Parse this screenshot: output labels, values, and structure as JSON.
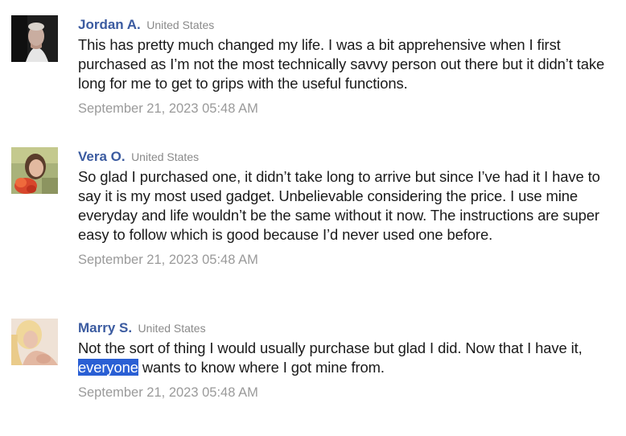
{
  "reviews": [
    {
      "name": "Jordan A.",
      "country": "United States",
      "text": "This has pretty much changed my life. I was a bit apprehensive when I first purchased as I’m not the most technically savvy person out there but it didn’t take long for me to get to grips with the useful functions.",
      "date": "September 21, 2023 05:48 AM"
    },
    {
      "name": "Vera O.",
      "country": "United States",
      "text": "So glad I purchased one, it didn’t take long to arrive but since I’ve had it I have to say it is my most used gadget. Unbelievable considering the price. I use mine everyday and life wouldn’t be the same without it now. The instructions are super easy to follow which is good because I’d never used one before.",
      "date": "September 21, 2023 05:48 AM"
    },
    {
      "name": "Marry S.",
      "country": "United States",
      "text_before": "Not the sort of thing I would usually purchase but glad I did. Now that I have it, ",
      "text_selected": "everyone",
      "text_after": " wants to know where I got mine from.",
      "date": "September 21, 2023 05:48 AM"
    }
  ],
  "colors": {
    "name": "#3b5ba0",
    "country": "#8a8a8a",
    "date": "#9a9a9a",
    "text": "#1a1a1a",
    "selection": "#2a5fd4"
  }
}
